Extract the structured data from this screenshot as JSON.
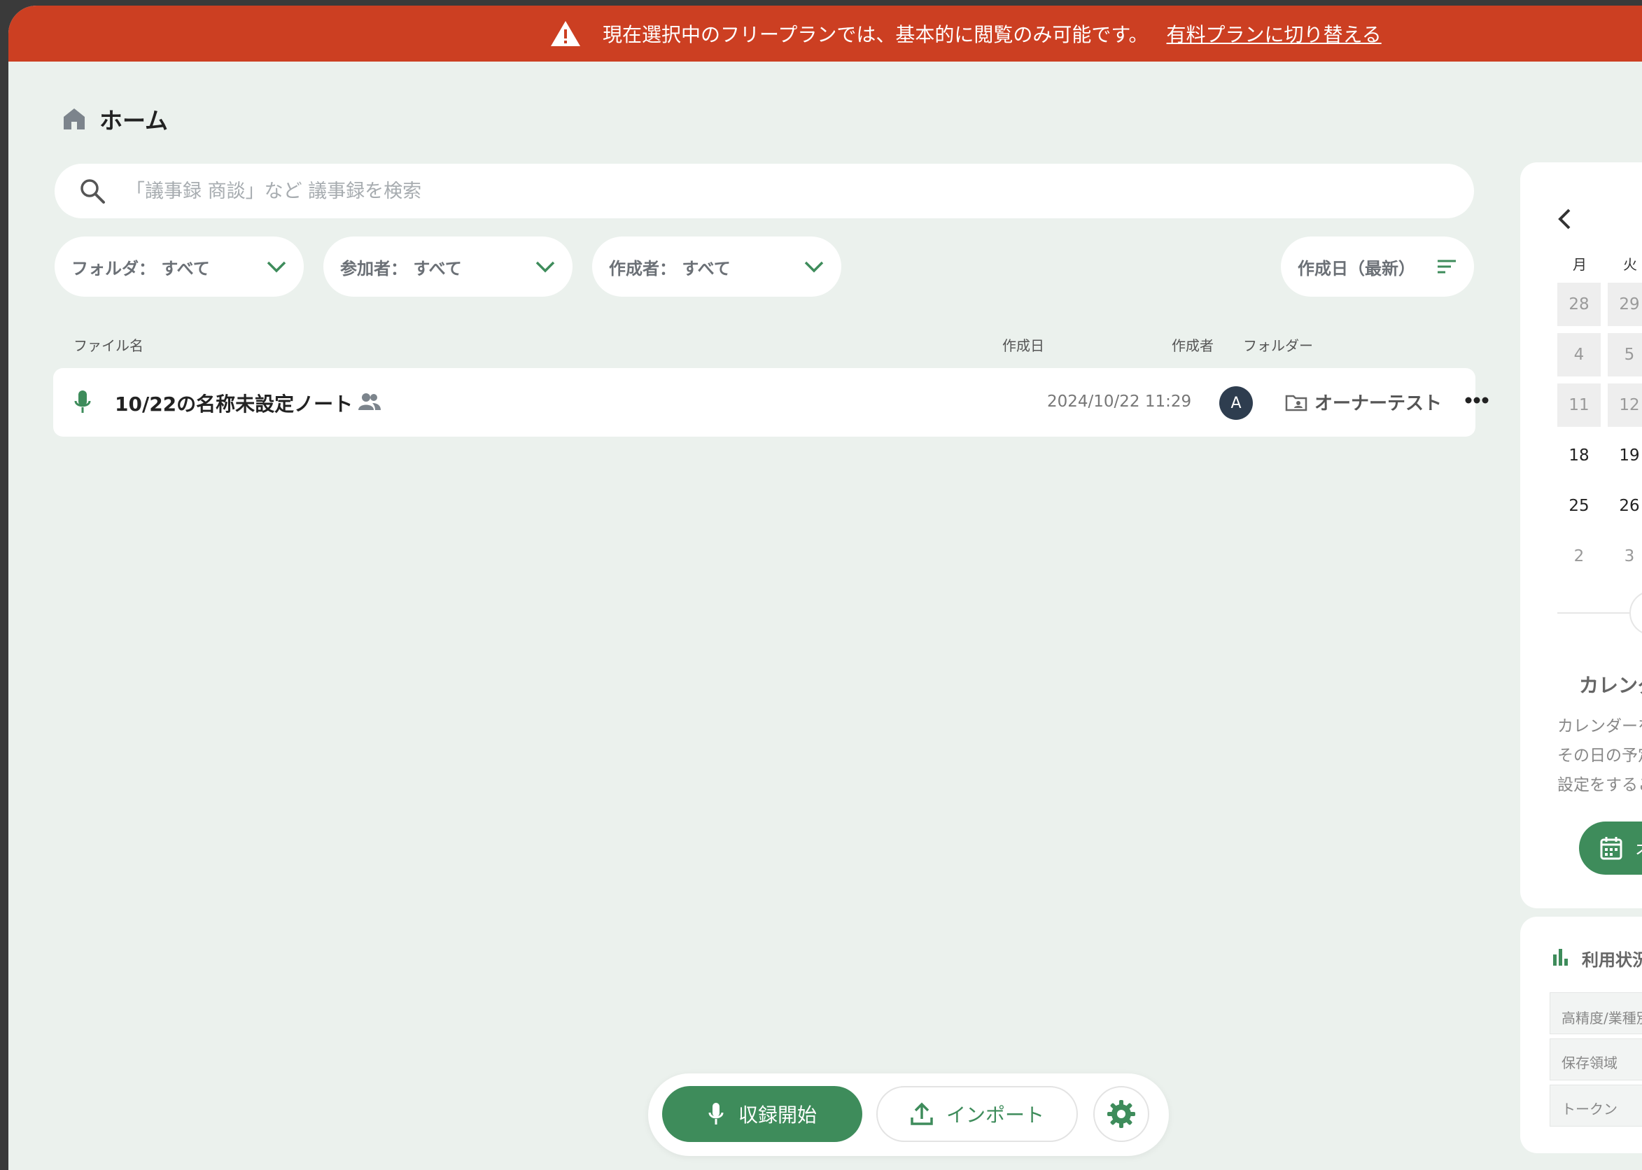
{
  "banner": {
    "message": "現在選択中のフリープランでは、基本的に閲覧のみ可能です。",
    "link_text": "有料プランに切り替える"
  },
  "breadcrumb": {
    "title": "ホーム"
  },
  "search": {
    "placeholder": "「議事録 商談」など 議事録を検索"
  },
  "filters": {
    "folder": "フォルダ： すべて",
    "participant": "参加者： すべて",
    "creator": "作成者： すべて",
    "sort": "作成日（最新）"
  },
  "table": {
    "headers": {
      "filename": "ファイル名",
      "created": "作成日",
      "creator": "作成者",
      "folder": "フォルダー"
    },
    "rows": [
      {
        "name": "10/22の名称未設定ノート",
        "date": "2024/10/22 11:29",
        "avatar": "A",
        "folder": "オーナーテスト"
      }
    ]
  },
  "calendar": {
    "weekdays": [
      "月",
      "火"
    ],
    "weeks": [
      [
        "28",
        "29"
      ],
      [
        "4",
        "5"
      ],
      [
        "11",
        "12"
      ],
      [
        "18",
        "19"
      ],
      [
        "25",
        "26"
      ],
      [
        "2",
        "3"
      ]
    ],
    "heading": "カレンダ",
    "desc": [
      "カレンダーを",
      "その日の予定",
      "設定をするこ"
    ],
    "button": "オ"
  },
  "usage": {
    "title": "利用状況",
    "rows": [
      "高精度/業種別",
      "保存領域",
      "トークン"
    ]
  },
  "dock": {
    "record": "収録開始",
    "import": "インポート"
  },
  "colors": {
    "accent": "#3e8c5b",
    "banner": "#cc3f22",
    "background": "#ebf1ed"
  }
}
